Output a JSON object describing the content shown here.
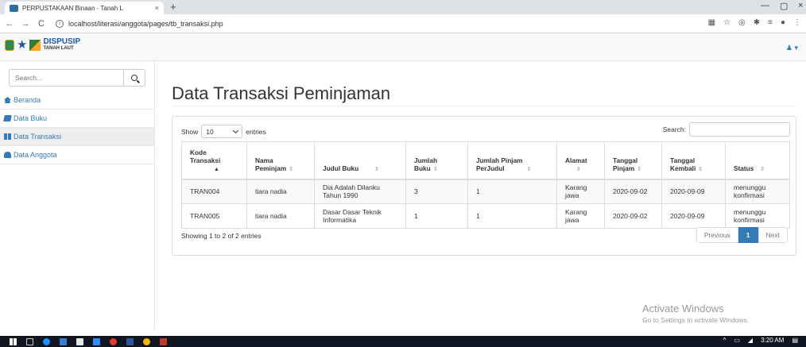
{
  "browser": {
    "tab_title": "PERPUSTAKAAN Binaan - Tanah L",
    "tab_close": "×",
    "new_tab": "+",
    "url": "localhost/literasi/anggota/pages/tb_transaksi.php",
    "minimize": "—",
    "maximize": "▢",
    "close": "×"
  },
  "app": {
    "logo_text": "DISPUSIP",
    "logo_sub": "TANAH LAUT",
    "user_menu": "▾"
  },
  "sidebar": {
    "search_placeholder": "Search...",
    "items": [
      {
        "label": "Beranda",
        "icon": "home-icon"
      },
      {
        "label": "Data Buku",
        "icon": "book-icon"
      },
      {
        "label": "Data Transaksi",
        "icon": "table-icon",
        "active": true
      },
      {
        "label": "Data Anggota",
        "icon": "user-icon"
      }
    ]
  },
  "page": {
    "title": "Data Transaksi Peminjaman",
    "show_label": "Show",
    "entries_label": "entries",
    "page_length": "10",
    "search_label": "Search:",
    "info": "Showing 1 to 2 of 2 entries",
    "pagination": {
      "previous": "Previous",
      "current": "1",
      "next": "Next"
    }
  },
  "table": {
    "columns": [
      {
        "line1": "Kode",
        "line2": "Transaksi",
        "sort": "▲"
      },
      {
        "line1": "Nama",
        "line2": "Peminjam",
        "sort": "⇕"
      },
      {
        "line1": "",
        "line2": "Judul Buku",
        "sort": "⇕"
      },
      {
        "line1": "Jumlah",
        "line2": "Buku",
        "sort": "⇕"
      },
      {
        "line1": "Jumlah Pinjam",
        "line2": "PerJudul",
        "sort": "⇕"
      },
      {
        "line1": "Alamat",
        "line2": "",
        "sort": "⇕"
      },
      {
        "line1": "Tanggal",
        "line2": "Pinjam",
        "sort": "⇕"
      },
      {
        "line1": "Tanggal",
        "line2": "Kembali",
        "sort": "⇕"
      },
      {
        "line1": "",
        "line2": "Status",
        "sort": "⇕"
      }
    ],
    "rows": [
      [
        "TRAN004",
        "tiara nadia",
        "Dia Adalah Dilanku Tahun 1990",
        "3",
        "1",
        "Karang jawa",
        "2020-09-02",
        "2020-09-09",
        "menunggu konfirmasi"
      ],
      [
        "TRAN005",
        "tiara nadia",
        "Dasar Dasar Teknik Informatika",
        "1",
        "1",
        "Karang jawa",
        "2020-09-02",
        "2020-09-09",
        "menunggu konfirmasi"
      ]
    ]
  },
  "watermark": {
    "line1": "Activate Windows",
    "line2": "Go to Settings to activate Windows."
  },
  "taskbar": {
    "time": "3:20 AM"
  }
}
